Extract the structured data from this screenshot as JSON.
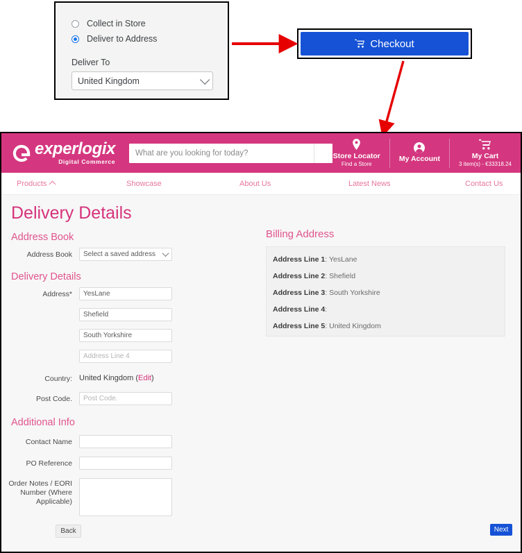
{
  "callout": {
    "options": [
      {
        "label": "Collect in Store",
        "selected": false
      },
      {
        "label": "Deliver to Address",
        "selected": true
      }
    ],
    "deliver_to_label": "Deliver To",
    "country_value": "United Kingdom"
  },
  "checkout": {
    "label": "Checkout",
    "icon": "shopping-cart-icon",
    "color": "#1552d6"
  },
  "header": {
    "brand": "experlogix",
    "brand_sub": "Digital Commerce",
    "brand_color": "#d4377f",
    "search_placeholder": "What are you looking for today?",
    "actions": [
      {
        "icon": "location-pin-icon",
        "title": "Store Locator",
        "sub": "Find a Store"
      },
      {
        "icon": "user-circle-icon",
        "title": "My Account",
        "sub": ""
      },
      {
        "icon": "shopping-cart-icon",
        "title": "My Cart",
        "sub": "3 item(s) - €33318.24"
      }
    ]
  },
  "nav": {
    "items": [
      {
        "label": "Products",
        "has_chevron": true
      },
      {
        "label": "Showcase",
        "has_chevron": false
      },
      {
        "label": "About Us",
        "has_chevron": false
      },
      {
        "label": "Latest News",
        "has_chevron": false
      },
      {
        "label": "Contact Us",
        "has_chevron": false
      }
    ]
  },
  "page": {
    "title": "Delivery Details",
    "accent": "#d6337c"
  },
  "address_book": {
    "heading": "Address Book",
    "label": "Address Book",
    "selected": "Select a saved address"
  },
  "delivery": {
    "heading": "Delivery Details",
    "address_label": "Address*",
    "line1": "YesLane",
    "line2": "Shefield",
    "line3": "South Yorkshire",
    "line4_placeholder": "Address Line 4",
    "country_label": "Country:",
    "country_value": "United Kingdom",
    "country_edit": "Edit",
    "postcode_label": "Post Code.",
    "postcode_placeholder": "Post Code."
  },
  "additional": {
    "heading": "Additional Info",
    "contact_name_label": "Contact Name",
    "contact_name_value": "",
    "po_reference_label": "PO Reference",
    "po_reference_value": "",
    "order_notes_label": "Order Notes / EORI Number (Where Applicable)",
    "order_notes_value": ""
  },
  "billing": {
    "heading": "Billing Address",
    "lines": [
      {
        "label": "Address Line 1",
        "value": "YesLane"
      },
      {
        "label": "Address Line 2",
        "value": "Shefield"
      },
      {
        "label": "Address Line 3",
        "value": "South Yorkshire"
      },
      {
        "label": "Address Line 4",
        "value": ""
      },
      {
        "label": "Address Line 5",
        "value": "United Kingdom"
      }
    ]
  },
  "buttons": {
    "back": "Back",
    "next": "Next"
  }
}
